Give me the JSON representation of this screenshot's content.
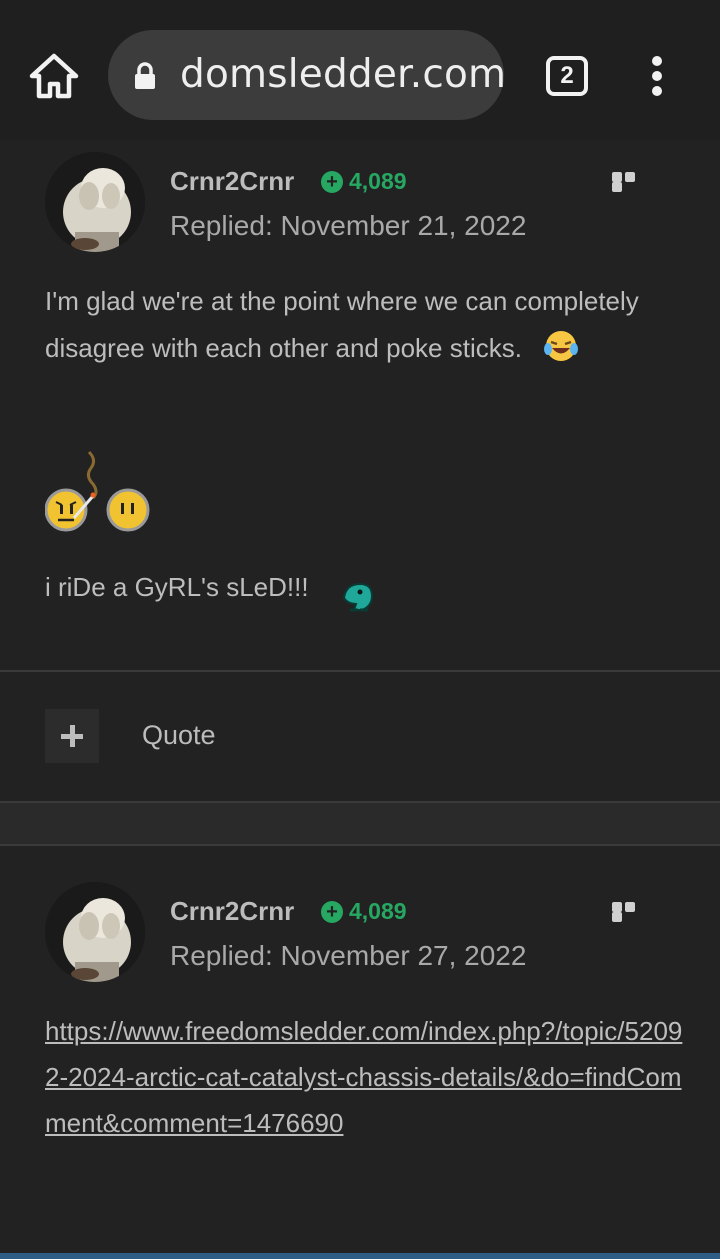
{
  "browser": {
    "url": "domsledder.com",
    "tab_count": "2"
  },
  "posts": [
    {
      "username": "Crnr2Crnr",
      "reputation": "4,089",
      "replied": "Replied: November 21, 2022",
      "text": "I'm glad we're at the point where we can completely disagree with each other and poke sticks.",
      "signature": "i riDe a GyRL's sLeD!!!"
    },
    {
      "username": "Crnr2Crnr",
      "reputation": "4,089",
      "replied": "Replied: November 27, 2022",
      "link": "https://www.freedomsledder.com/index.php?/topic/52092-2024-arctic-cat-catalyst-chassis-details/&do=findComment&comment=1476690"
    }
  ],
  "actions": {
    "quote_label": "Quote"
  },
  "colors": {
    "background": "#222222",
    "reputation": "#26a862",
    "topbar": "#1f1f1f"
  }
}
